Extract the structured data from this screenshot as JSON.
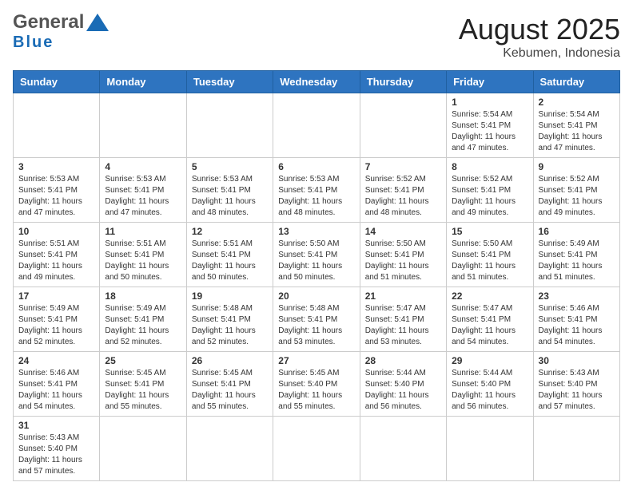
{
  "header": {
    "logo_general": "General",
    "logo_blue": "Blue",
    "month_year": "August 2025",
    "location": "Kebumen, Indonesia"
  },
  "weekdays": [
    "Sunday",
    "Monday",
    "Tuesday",
    "Wednesday",
    "Thursday",
    "Friday",
    "Saturday"
  ],
  "weeks": [
    [
      {
        "day": "",
        "info": ""
      },
      {
        "day": "",
        "info": ""
      },
      {
        "day": "",
        "info": ""
      },
      {
        "day": "",
        "info": ""
      },
      {
        "day": "",
        "info": ""
      },
      {
        "day": "1",
        "info": "Sunrise: 5:54 AM\nSunset: 5:41 PM\nDaylight: 11 hours\nand 47 minutes."
      },
      {
        "day": "2",
        "info": "Sunrise: 5:54 AM\nSunset: 5:41 PM\nDaylight: 11 hours\nand 47 minutes."
      }
    ],
    [
      {
        "day": "3",
        "info": "Sunrise: 5:53 AM\nSunset: 5:41 PM\nDaylight: 11 hours\nand 47 minutes."
      },
      {
        "day": "4",
        "info": "Sunrise: 5:53 AM\nSunset: 5:41 PM\nDaylight: 11 hours\nand 47 minutes."
      },
      {
        "day": "5",
        "info": "Sunrise: 5:53 AM\nSunset: 5:41 PM\nDaylight: 11 hours\nand 48 minutes."
      },
      {
        "day": "6",
        "info": "Sunrise: 5:53 AM\nSunset: 5:41 PM\nDaylight: 11 hours\nand 48 minutes."
      },
      {
        "day": "7",
        "info": "Sunrise: 5:52 AM\nSunset: 5:41 PM\nDaylight: 11 hours\nand 48 minutes."
      },
      {
        "day": "8",
        "info": "Sunrise: 5:52 AM\nSunset: 5:41 PM\nDaylight: 11 hours\nand 49 minutes."
      },
      {
        "day": "9",
        "info": "Sunrise: 5:52 AM\nSunset: 5:41 PM\nDaylight: 11 hours\nand 49 minutes."
      }
    ],
    [
      {
        "day": "10",
        "info": "Sunrise: 5:51 AM\nSunset: 5:41 PM\nDaylight: 11 hours\nand 49 minutes."
      },
      {
        "day": "11",
        "info": "Sunrise: 5:51 AM\nSunset: 5:41 PM\nDaylight: 11 hours\nand 50 minutes."
      },
      {
        "day": "12",
        "info": "Sunrise: 5:51 AM\nSunset: 5:41 PM\nDaylight: 11 hours\nand 50 minutes."
      },
      {
        "day": "13",
        "info": "Sunrise: 5:50 AM\nSunset: 5:41 PM\nDaylight: 11 hours\nand 50 minutes."
      },
      {
        "day": "14",
        "info": "Sunrise: 5:50 AM\nSunset: 5:41 PM\nDaylight: 11 hours\nand 51 minutes."
      },
      {
        "day": "15",
        "info": "Sunrise: 5:50 AM\nSunset: 5:41 PM\nDaylight: 11 hours\nand 51 minutes."
      },
      {
        "day": "16",
        "info": "Sunrise: 5:49 AM\nSunset: 5:41 PM\nDaylight: 11 hours\nand 51 minutes."
      }
    ],
    [
      {
        "day": "17",
        "info": "Sunrise: 5:49 AM\nSunset: 5:41 PM\nDaylight: 11 hours\nand 52 minutes."
      },
      {
        "day": "18",
        "info": "Sunrise: 5:49 AM\nSunset: 5:41 PM\nDaylight: 11 hours\nand 52 minutes."
      },
      {
        "day": "19",
        "info": "Sunrise: 5:48 AM\nSunset: 5:41 PM\nDaylight: 11 hours\nand 52 minutes."
      },
      {
        "day": "20",
        "info": "Sunrise: 5:48 AM\nSunset: 5:41 PM\nDaylight: 11 hours\nand 53 minutes."
      },
      {
        "day": "21",
        "info": "Sunrise: 5:47 AM\nSunset: 5:41 PM\nDaylight: 11 hours\nand 53 minutes."
      },
      {
        "day": "22",
        "info": "Sunrise: 5:47 AM\nSunset: 5:41 PM\nDaylight: 11 hours\nand 54 minutes."
      },
      {
        "day": "23",
        "info": "Sunrise: 5:46 AM\nSunset: 5:41 PM\nDaylight: 11 hours\nand 54 minutes."
      }
    ],
    [
      {
        "day": "24",
        "info": "Sunrise: 5:46 AM\nSunset: 5:41 PM\nDaylight: 11 hours\nand 54 minutes."
      },
      {
        "day": "25",
        "info": "Sunrise: 5:45 AM\nSunset: 5:41 PM\nDaylight: 11 hours\nand 55 minutes."
      },
      {
        "day": "26",
        "info": "Sunrise: 5:45 AM\nSunset: 5:41 PM\nDaylight: 11 hours\nand 55 minutes."
      },
      {
        "day": "27",
        "info": "Sunrise: 5:45 AM\nSunset: 5:40 PM\nDaylight: 11 hours\nand 55 minutes."
      },
      {
        "day": "28",
        "info": "Sunrise: 5:44 AM\nSunset: 5:40 PM\nDaylight: 11 hours\nand 56 minutes."
      },
      {
        "day": "29",
        "info": "Sunrise: 5:44 AM\nSunset: 5:40 PM\nDaylight: 11 hours\nand 56 minutes."
      },
      {
        "day": "30",
        "info": "Sunrise: 5:43 AM\nSunset: 5:40 PM\nDaylight: 11 hours\nand 57 minutes."
      }
    ],
    [
      {
        "day": "31",
        "info": "Sunrise: 5:43 AM\nSunset: 5:40 PM\nDaylight: 11 hours\nand 57 minutes."
      },
      {
        "day": "",
        "info": ""
      },
      {
        "day": "",
        "info": ""
      },
      {
        "day": "",
        "info": ""
      },
      {
        "day": "",
        "info": ""
      },
      {
        "day": "",
        "info": ""
      },
      {
        "day": "",
        "info": ""
      }
    ]
  ]
}
